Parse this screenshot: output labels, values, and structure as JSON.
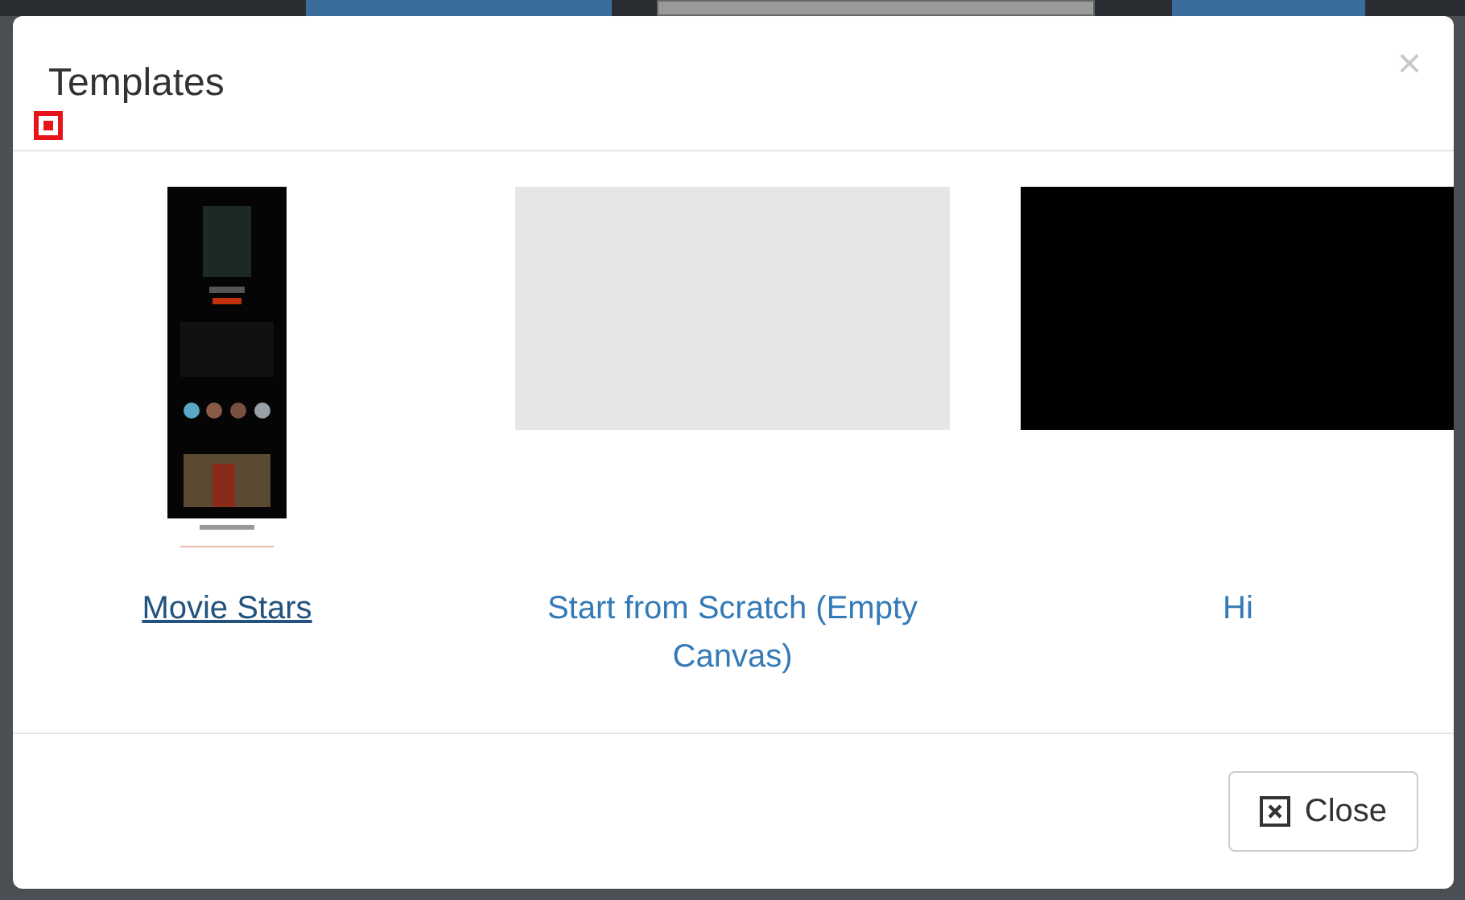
{
  "background_toolbar": {
    "buttons": [
      {
        "kind": "primary"
      },
      {
        "kind": "default"
      },
      {
        "kind": "primary"
      }
    ]
  },
  "modal": {
    "title": "Templates",
    "close_symbol": "×",
    "templates": [
      {
        "name": "Movie Stars",
        "hovered": true
      },
      {
        "name": "Start from Scratch (Empty Canvas)",
        "hovered": false,
        "thumbnail": {
          "kind": "blank",
          "color": "#e6e6e6"
        }
      },
      {
        "name": "Hi",
        "hovered": false,
        "thumbnail": {
          "kind": "blank",
          "color": "#000000"
        }
      }
    ],
    "footer_button": "Close"
  }
}
